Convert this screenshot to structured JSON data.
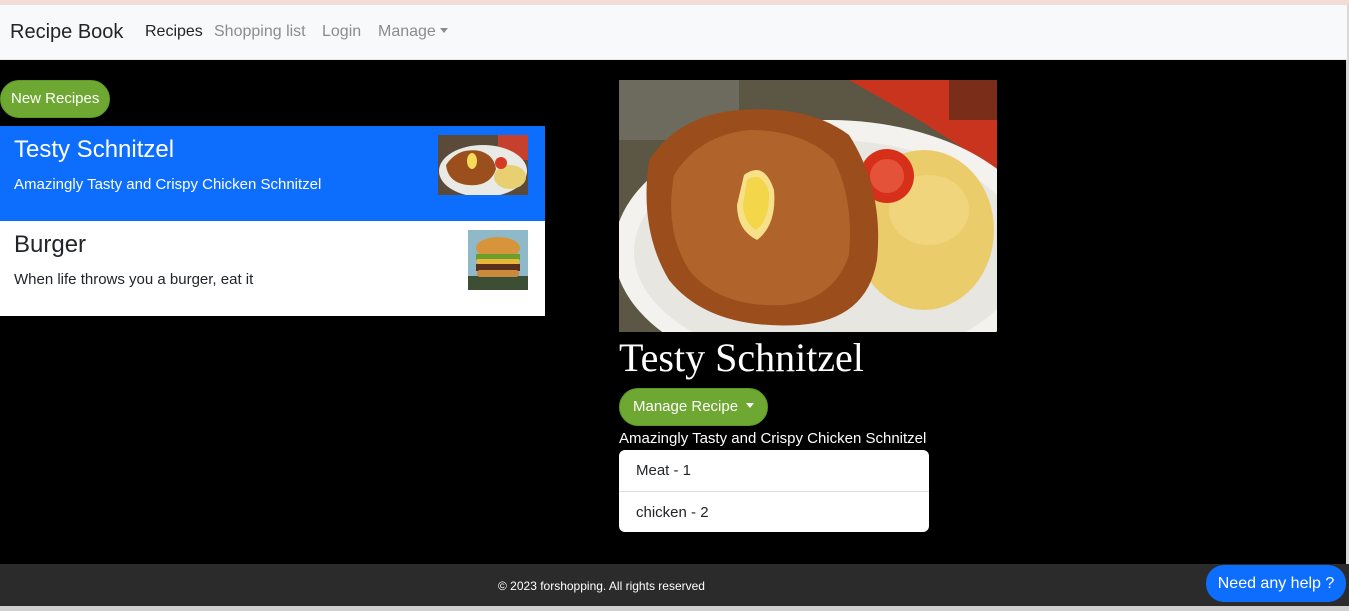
{
  "navbar": {
    "brand": "Recipe Book",
    "links": [
      "Recipes",
      "Shopping list",
      "Login",
      "Manage"
    ]
  },
  "actions": {
    "new_recipe": "New Recipes"
  },
  "recipes": [
    {
      "title": "Testy Schnitzel",
      "description": "Amazingly Tasty and Crispy Chicken Schnitzel",
      "active": true
    },
    {
      "title": "Burger",
      "description": "When life throws you a burger, eat it",
      "active": false
    }
  ],
  "detail": {
    "title": "Testy Schnitzel",
    "manage_button": "Manage Recipe",
    "description": "Amazingly Tasty and Crispy Chicken Schnitzel",
    "ingredients": [
      "Meat - 1",
      "chicken - 2"
    ]
  },
  "footer": {
    "text": "© 2023 forshopping. All rights reserved"
  },
  "help": {
    "label": "Need any help ?"
  },
  "colors": {
    "accent_green": "#6ea832",
    "primary_blue": "#0d6efd",
    "background": "#000000"
  }
}
